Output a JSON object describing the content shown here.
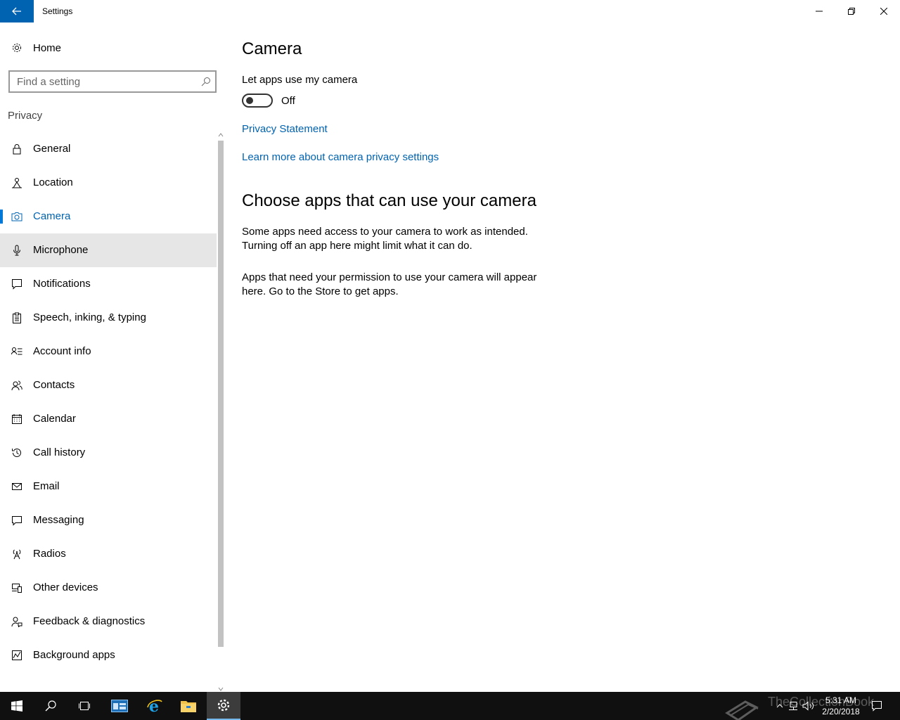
{
  "window": {
    "title": "Settings",
    "back_icon": "back-arrow-icon",
    "minimize_icon": "minimize-icon",
    "maximize_icon": "restore-icon",
    "close_icon": "close-icon"
  },
  "sidebar": {
    "home_label": "Home",
    "home_icon": "gear-icon",
    "search_placeholder": "Find a setting",
    "search_icon": "search-icon",
    "section_title": "Privacy",
    "items": [
      {
        "label": "General",
        "icon": "lock-icon"
      },
      {
        "label": "Location",
        "icon": "location-person-icon"
      },
      {
        "label": "Camera",
        "icon": "camera-icon",
        "selected": true
      },
      {
        "label": "Microphone",
        "icon": "microphone-icon",
        "hover": true
      },
      {
        "label": "Notifications",
        "icon": "notification-icon"
      },
      {
        "label": "Speech, inking, & typing",
        "icon": "clipboard-icon"
      },
      {
        "label": "Account info",
        "icon": "account-info-icon"
      },
      {
        "label": "Contacts",
        "icon": "contacts-icon"
      },
      {
        "label": "Calendar",
        "icon": "calendar-icon"
      },
      {
        "label": "Call history",
        "icon": "history-icon"
      },
      {
        "label": "Email",
        "icon": "mail-icon"
      },
      {
        "label": "Messaging",
        "icon": "message-icon"
      },
      {
        "label": "Radios",
        "icon": "radio-tower-icon"
      },
      {
        "label": "Other devices",
        "icon": "devices-icon"
      },
      {
        "label": "Feedback & diagnostics",
        "icon": "feedback-icon"
      },
      {
        "label": "Background apps",
        "icon": "background-apps-icon"
      }
    ]
  },
  "main": {
    "title": "Camera",
    "setting_label": "Let apps use my camera",
    "toggle_state": "Off",
    "link_privacy": "Privacy Statement",
    "link_learn": "Learn more about camera privacy settings",
    "section_heading": "Choose apps that can use your camera",
    "para1": "Some apps need access to your camera to work as intended. Turning off an app here might limit what it can do.",
    "para2": "Apps that need your permission to use your camera will appear here. Go to the Store to get apps."
  },
  "taskbar": {
    "time": "5:31 AM",
    "date": "2/20/2018",
    "watermark": "TheCollectionBook",
    "buttons": [
      "windows-start-icon",
      "search-icon",
      "task-view-icon",
      "server-manager-icon",
      "internet-explorer-icon",
      "file-explorer-icon",
      "settings-gear-icon"
    ],
    "tray_icons": [
      "chevron-up-icon",
      "network-icon",
      "volume-icon",
      "action-center-icon"
    ]
  },
  "colors": {
    "accent": "#0078d7",
    "link": "#0063b1",
    "back_button": "#0063b1",
    "hover": "#e6e6e6",
    "taskbar": "#101010"
  }
}
